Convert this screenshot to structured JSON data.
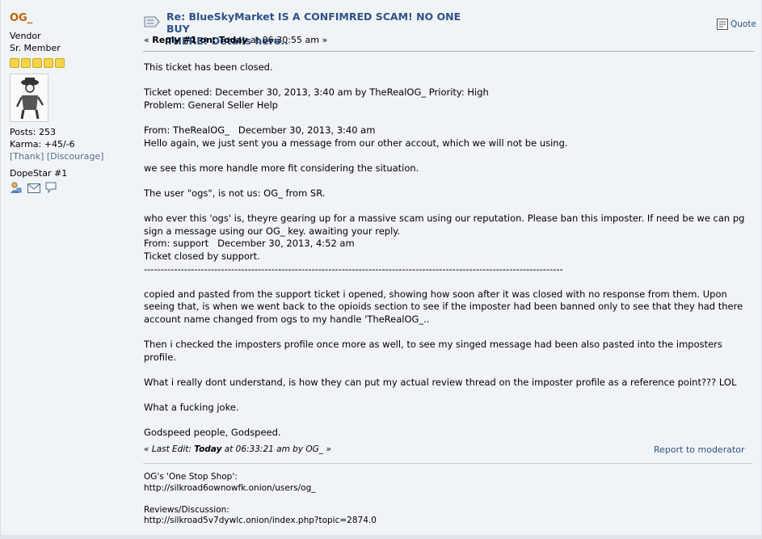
{
  "poster": {
    "name": "OG_",
    "group": "Vendor",
    "rank": "Sr. Member",
    "posts": "Posts: 253",
    "karma": "Karma: +45/-6",
    "thank": "[Thank]",
    "discourage": "[Discourage]",
    "award": "DopeStar #1"
  },
  "post": {
    "subject_line1": "Re: BlueSkyMarket IS A CONFIMRED SCAM! NO ONE BUY",
    "subject_line2": "THERE! Details here..",
    "meta_prefix": "«",
    "meta_reply": "Reply #1 on:",
    "meta_today": "Today",
    "meta_time": "at 06:30:55 am",
    "meta_suffix": "»",
    "quote_label": "Quote"
  },
  "body": {
    "l1": "This ticket has been closed.",
    "l2": "Ticket opened: December 30, 2013, 3:40 am by TheRealOG_ Priority: High",
    "l3": "Problem: General Seller Help",
    "l4": "From: TheRealOG_   December 30, 2013, 3:40 am",
    "l5": "Hello again, we just sent you a message from our other accout, which we will not be using.",
    "l6": "we see this more handle more fit considering the situation.",
    "l7": "The user \"ogs\", is not us: OG_ from SR.",
    "l8": "who ever this 'ogs' is, theyre gearing up for a massive scam using our reputation. Please ban this imposter. If need be we can pg sign a message using our OG_ key. awaiting your reply.",
    "l9": "From: support   December 30, 2013, 4:52 am",
    "l10": "Ticket closed by support.",
    "sep": "-----------------------------------------------------------------------------------------------------------------------------",
    "l11": "copied and pasted from the support ticket i opened, showing how soon after it was closed with no response from them. Upon seeing that, is when we went back to the opioids section to see if the imposter had been banned only to see that they had there account name changed from ogs to my handle 'TheRealOG_..",
    "l12": "Then i checked the imposters profile once more as well, to see my singed message had been also pasted into the imposters profile.",
    "l13": "What i really dont understand, is how they can put my actual review thread on the imposter profile as a reference point??? LOL",
    "l14": "What a fucking joke.",
    "l15": "Godspeed people, Godspeed."
  },
  "footer": {
    "edit_prefix": "«",
    "edit_label": "Last Edit:",
    "edit_today": "Today",
    "edit_rest": "at 06:33:21 am by OG_",
    "edit_suffix": "»",
    "report": "Report to moderator"
  },
  "signature": {
    "s1": "OG's 'One Stop Shop':",
    "s2": "http://silkroad6ownowfk.onion/users/og_",
    "s3": "Reviews/Discussion:",
    "s4": "http://silkroad5v7dywlc.onion/index.php?topic=2874.0"
  },
  "colors": {
    "name": "#c06002",
    "link": "#2f5187",
    "background": "#f0f4f7"
  }
}
